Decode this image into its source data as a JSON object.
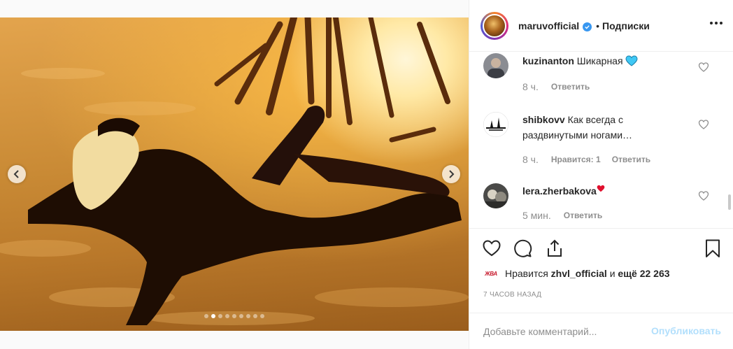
{
  "post": {
    "carousel": {
      "slide_count": 9,
      "active_index": 1
    }
  },
  "header": {
    "username": "maruvofficial",
    "separator": "•",
    "follow_label": "Подписки"
  },
  "comments": [
    {
      "username": "kuzinanton",
      "text": "Шикарная",
      "emoji": "blue-heart",
      "time": "8 ч.",
      "likes": "",
      "reply": "Ответить"
    },
    {
      "username": "shibkovv",
      "text": "Как всегда с раздвинутыми ногами…",
      "time": "8 ч.",
      "likes": "Нравится: 1",
      "reply": "Ответить"
    },
    {
      "username": "lera.zherbakova",
      "text": "",
      "emoji": "red-heart",
      "time": "5 мин.",
      "likes": "",
      "reply": "Ответить"
    }
  ],
  "likes": {
    "avatar_text": "ЖВА",
    "prefix": "Нравится",
    "user": "zhvl_official",
    "middle": "и",
    "rest": "ещё 22 263"
  },
  "timeago": "7 ЧАСОВ НАЗАД",
  "add_comment": {
    "placeholder": "Добавьте комментарий...",
    "publish_label": "Опубликовать"
  },
  "icons": {
    "like": "heart-outline-icon",
    "comment": "comment-bubble-icon",
    "share": "share-icon",
    "save": "bookmark-icon",
    "more": "more-dots-icon"
  },
  "colors": {
    "link": "#3897f0",
    "publish_disabled": "#b2dffc",
    "blue_heart": "#3fc8f5",
    "red_heart": "#e0102e"
  }
}
